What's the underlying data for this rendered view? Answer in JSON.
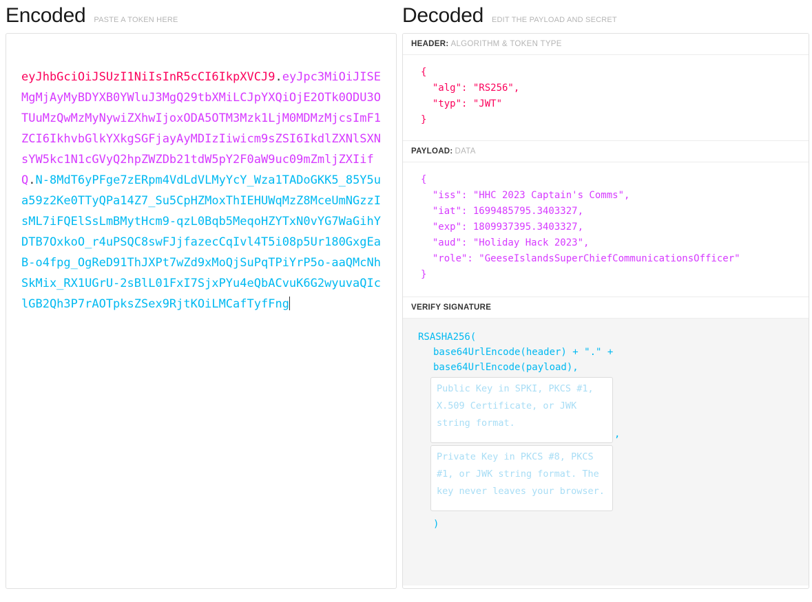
{
  "encoded": {
    "title": "Encoded",
    "subtitle": "PASTE A TOKEN HERE",
    "token": {
      "header": "eyJhbGciOiJSUzI1NiIsInR5cCI6IkpXVCJ9",
      "dot1": ".",
      "payload": "eyJpc3MiOiJISEMgMjAyMyBDYXB0YWluJ3MgQ29tbXMiLCJpYXQiOjE2OTk0ODU3OTUuMzQwMzMyNywiZXhwIjoxODA5OTM3Mzk1LjM0MDMzMjcsImF1ZCI6IkhvbGlkYXkgSGFjayAyMDIzIiwicm9sZSI6IkdlZXNlSXNsYW5kc1N1cGVyQ2hpZWZDb21tdW5pY2F0aW9uc09mZmljZXIifQ",
      "dot2": ".",
      "signature": "N-8MdT6yPFge7zERpm4VdLdVLMyYcY_Wza1TADoGKK5_85Y5ua59z2Ke0TTyQPa14Z7_Su5CpHZMoxThIEHUWqMzZ8MceUmNGzzIsML7iFQElSsLmBMytHcm9-qzL0Bqb5MeqoHZYTxN0vYG7WaGihYDTB7OxkoO_r4uPSQC8swFJjfazecCqIvl4T5i08p5Ur180GxgEaB-o4fpg_OgReD91ThJXPt7wZd9xMoQjSuPqTPiYrP5o-aaQMcNhSkMix_RX1UGrU-2sBlL01FxI7SjxPYu4eQbACvuK6G2wyuvaQIclGB2Qh3P7rAOTpksZSex9RjtKOiLMCafTyfFng"
    }
  },
  "decoded": {
    "title": "Decoded",
    "subtitle": "EDIT THE PAYLOAD AND SECRET",
    "header_label_strong": "HEADER:",
    "header_label_muted": "ALGORITHM & TOKEN TYPE",
    "header_json": "{\n  \"alg\": \"RS256\",\n  \"typ\": \"JWT\"\n}",
    "payload_label_strong": "PAYLOAD:",
    "payload_label_muted": "DATA",
    "payload_json": "{\n  \"iss\": \"HHC 2023 Captain's Comms\",\n  \"iat\": 1699485795.3403327,\n  \"exp\": 1809937395.3403327,\n  \"aud\": \"Holiday Hack 2023\",\n  \"role\": \"GeeseIslandsSuperChiefCommunicationsOfficer\"\n}",
    "verify_label": "VERIFY SIGNATURE",
    "sig_line1": "RSASHA256(",
    "sig_line2": "base64UrlEncode(header) + \".\" +",
    "sig_line3": "base64UrlEncode(payload),",
    "public_key_placeholder": "Public Key in SPKI, PKCS #1, X.509 Certificate, or JWK string format.",
    "public_key_value": "",
    "comma": ",",
    "private_key_placeholder": "Private Key in PKCS #8, PKCS #1, or JWK string format. The key never leaves your browser.",
    "private_key_value": "",
    "sig_close": ")"
  },
  "colors": {
    "header_segment": "#fb015b",
    "payload_segment": "#d63aff",
    "signature_segment": "#00b9f1",
    "panel_border": "#e0e0e0",
    "muted_text": "#b5b5b5",
    "sig_background": "#f5f5f5"
  }
}
